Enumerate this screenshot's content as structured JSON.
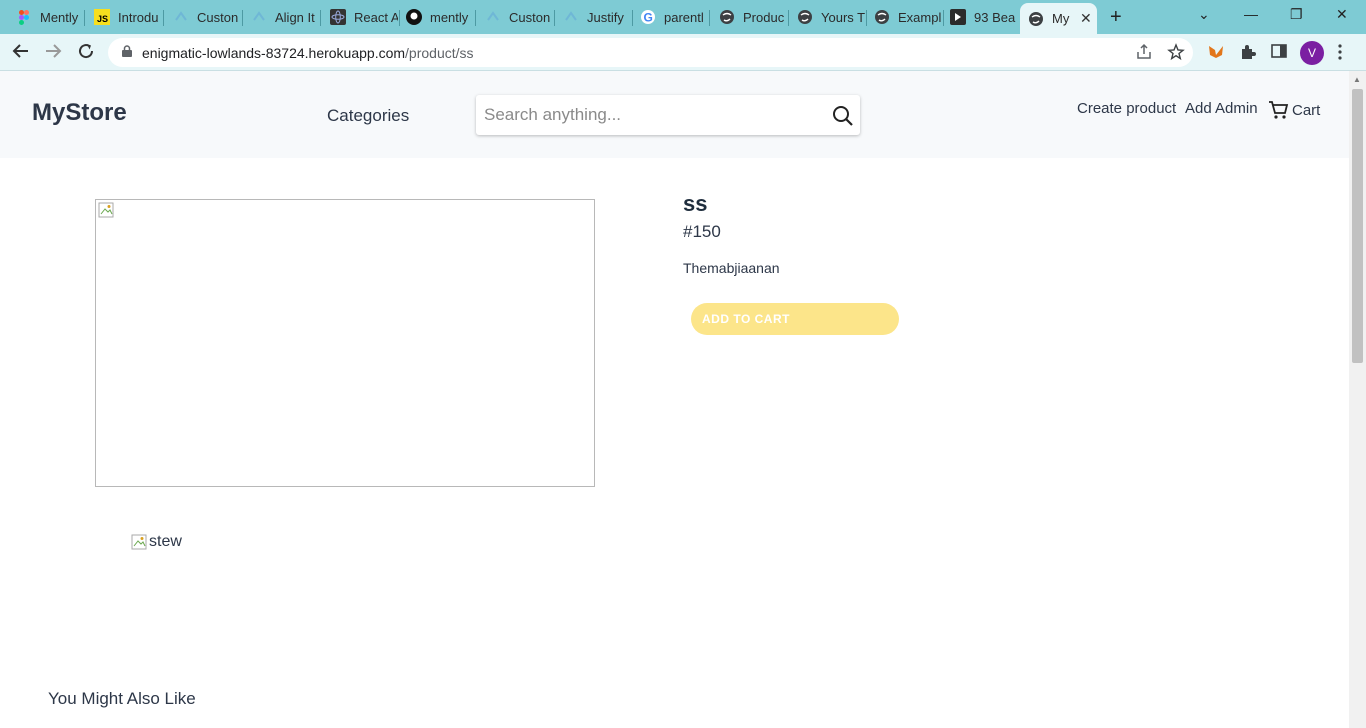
{
  "browser": {
    "tabs": [
      {
        "title": "Mently",
        "icon": "figma-icon"
      },
      {
        "title": "Introdu",
        "icon": "js-icon"
      },
      {
        "title": "Custon",
        "icon": "web-icon"
      },
      {
        "title": "Align It",
        "icon": "web-icon"
      },
      {
        "title": "React A",
        "icon": "react-icon"
      },
      {
        "title": "mently",
        "icon": "github-icon"
      },
      {
        "title": "Custon",
        "icon": "web-icon"
      },
      {
        "title": "Justify",
        "icon": "web-icon"
      },
      {
        "title": "parentl",
        "icon": "google-icon"
      },
      {
        "title": "Produc",
        "icon": "globe-icon"
      },
      {
        "title": "Yours T",
        "icon": "globe-icon"
      },
      {
        "title": "Exampl",
        "icon": "globe-icon"
      },
      {
        "title": "93 Bea",
        "icon": "app-icon"
      },
      {
        "title": "My",
        "icon": "globe-icon",
        "active": true
      }
    ],
    "url_host": "enigmatic-lowlands-83724.herokuapp.com",
    "url_path": "/product/ss",
    "profile_initial": "V"
  },
  "header": {
    "logo": "MyStore",
    "categories": "Categories",
    "search_placeholder": "Search anything...",
    "create_product": "Create product",
    "add_admin": "Add Admin",
    "cart": "Cart"
  },
  "product": {
    "title": "ss",
    "id": "#150",
    "description": "Themabjiaanan",
    "add_to_cart": "ADD TO CART",
    "thumb_alt": "stew"
  },
  "sections": {
    "also_like": "You Might Also Like"
  },
  "colors": {
    "tabbar": "#7ecbd4",
    "add_to_cart_bg": "#fce58a",
    "header_bg": "#f7f9fb"
  }
}
